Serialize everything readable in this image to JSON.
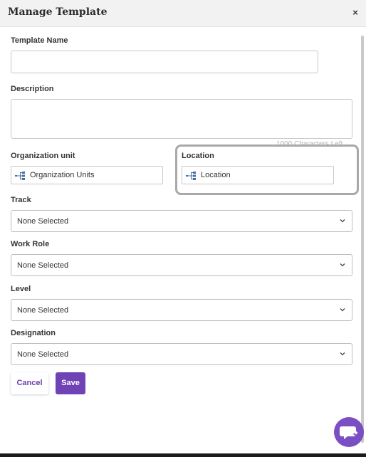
{
  "modal": {
    "title": "Manage Template",
    "close_glyph": "×"
  },
  "form": {
    "template_name": {
      "label": "Template Name",
      "value": "",
      "placeholder": ""
    },
    "description": {
      "label": "Description",
      "value": "",
      "char_count": "1000 Characters Left"
    },
    "organization_unit": {
      "label": "Organization unit",
      "value": "Organization Units",
      "icon": "tree-icon"
    },
    "location": {
      "label": "Location",
      "value": "Location",
      "icon": "tree-icon"
    },
    "track": {
      "label": "Track",
      "value": "None Selected"
    },
    "work_role": {
      "label": "Work Role",
      "value": "None Selected"
    },
    "level": {
      "label": "Level",
      "value": "None Selected"
    },
    "designation": {
      "label": "Designation",
      "value": "None Selected"
    }
  },
  "actions": {
    "cancel_label": "Cancel",
    "save_label": "Save"
  },
  "chat": {
    "icon": "chat-icon"
  },
  "colors": {
    "accent": "#6f42b5",
    "chat": "#7b4fc4",
    "header_bg": "#f2f2f2",
    "highlight_border": "#a9a9a9"
  }
}
